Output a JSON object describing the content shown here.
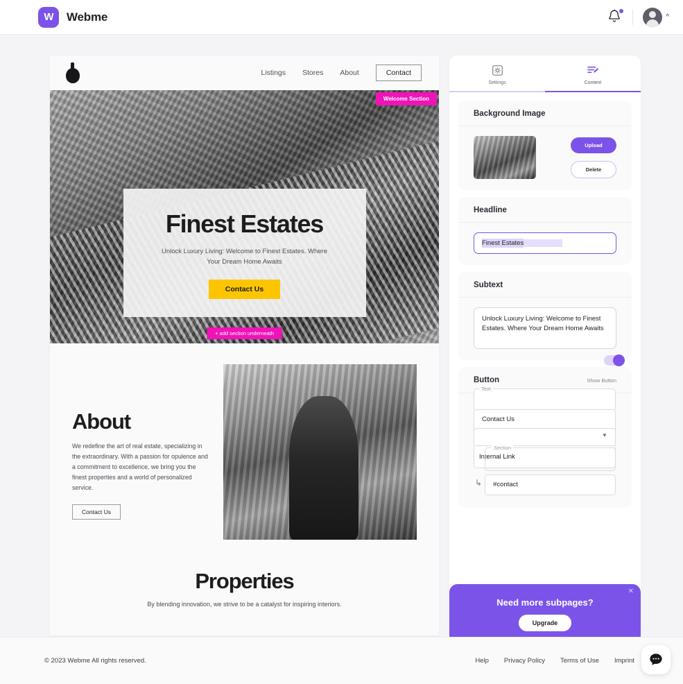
{
  "topbar": {
    "brand_mark": "W",
    "brand_name": "Webme",
    "bell_icon": "bell-icon",
    "avatar_icon": "avatar-icon",
    "caret_icon": "chevron-up-icon"
  },
  "site_preview": {
    "logo_icon": "lamp-logo-icon",
    "nav": [
      {
        "label": "Listings"
      },
      {
        "label": "Stores"
      },
      {
        "label": "About"
      }
    ],
    "nav_cta": "Contact",
    "hero": {
      "badge": "Welcome Section",
      "title": "Finest Estates",
      "subtitle": "Unlock Luxury Living: Welcome to Finest Estates. Where Your Dream Home Awaits",
      "button": "Contact Us",
      "add_section": "+ add section underneath"
    },
    "about": {
      "title": "About",
      "body": "We redefine the art of real estate, specializing in the extraordinary. With a passion for opulence and a commitment to excellence, we bring you the finest properties and a world of personalized service.",
      "button": "Contact Us"
    },
    "properties": {
      "title": "Properties",
      "subtitle": "By blending innovation, we strive to be a catalyst for inspiring interiors."
    }
  },
  "panel": {
    "tabs": [
      {
        "label": "Settings",
        "icon": "gear-icon",
        "active": false
      },
      {
        "label": "Content",
        "icon": "content-edit-icon",
        "active": true
      }
    ],
    "background_image": {
      "title": "Background Image",
      "thumbnail_alt": "skyscraper-thumbnail",
      "upload_label": "Upload",
      "delete_label": "Delete"
    },
    "headline": {
      "title": "Headline",
      "value": "Finest Estates",
      "selected": true
    },
    "subtext": {
      "title": "Subtext",
      "value": "Unlock Luxury Living: Welcome to Finest Estates. Where Your Dream Home Awaits",
      "toggle_on": true
    },
    "button": {
      "title": "Button",
      "show_button_label": "Show Button",
      "text_label": "Text",
      "text_value": "Contact Us",
      "section_label": "Section",
      "link_type_value": "Internal Link",
      "anchor_value": "#contact",
      "dropdown_icon": "chevron-down-icon",
      "branch_icon": "corner-down-right-icon"
    }
  },
  "upgrade": {
    "title": "Need more subpages?",
    "button": "Upgrade",
    "close_icon": "close-icon"
  },
  "footer": {
    "copyright": "© 2023 Webme All rights reserved.",
    "links": [
      {
        "label": "Help"
      },
      {
        "label": "Privacy Policy"
      },
      {
        "label": "Terms of Use"
      },
      {
        "label": "Imprint"
      }
    ],
    "chat_icon": "chat-bubble-icon"
  },
  "colors": {
    "brand_purple": "#7c53e8",
    "selection_magenta": "#ef13b8",
    "hero_cta_yellow": "#fdc500",
    "page_bg": "#f4f4f7"
  }
}
